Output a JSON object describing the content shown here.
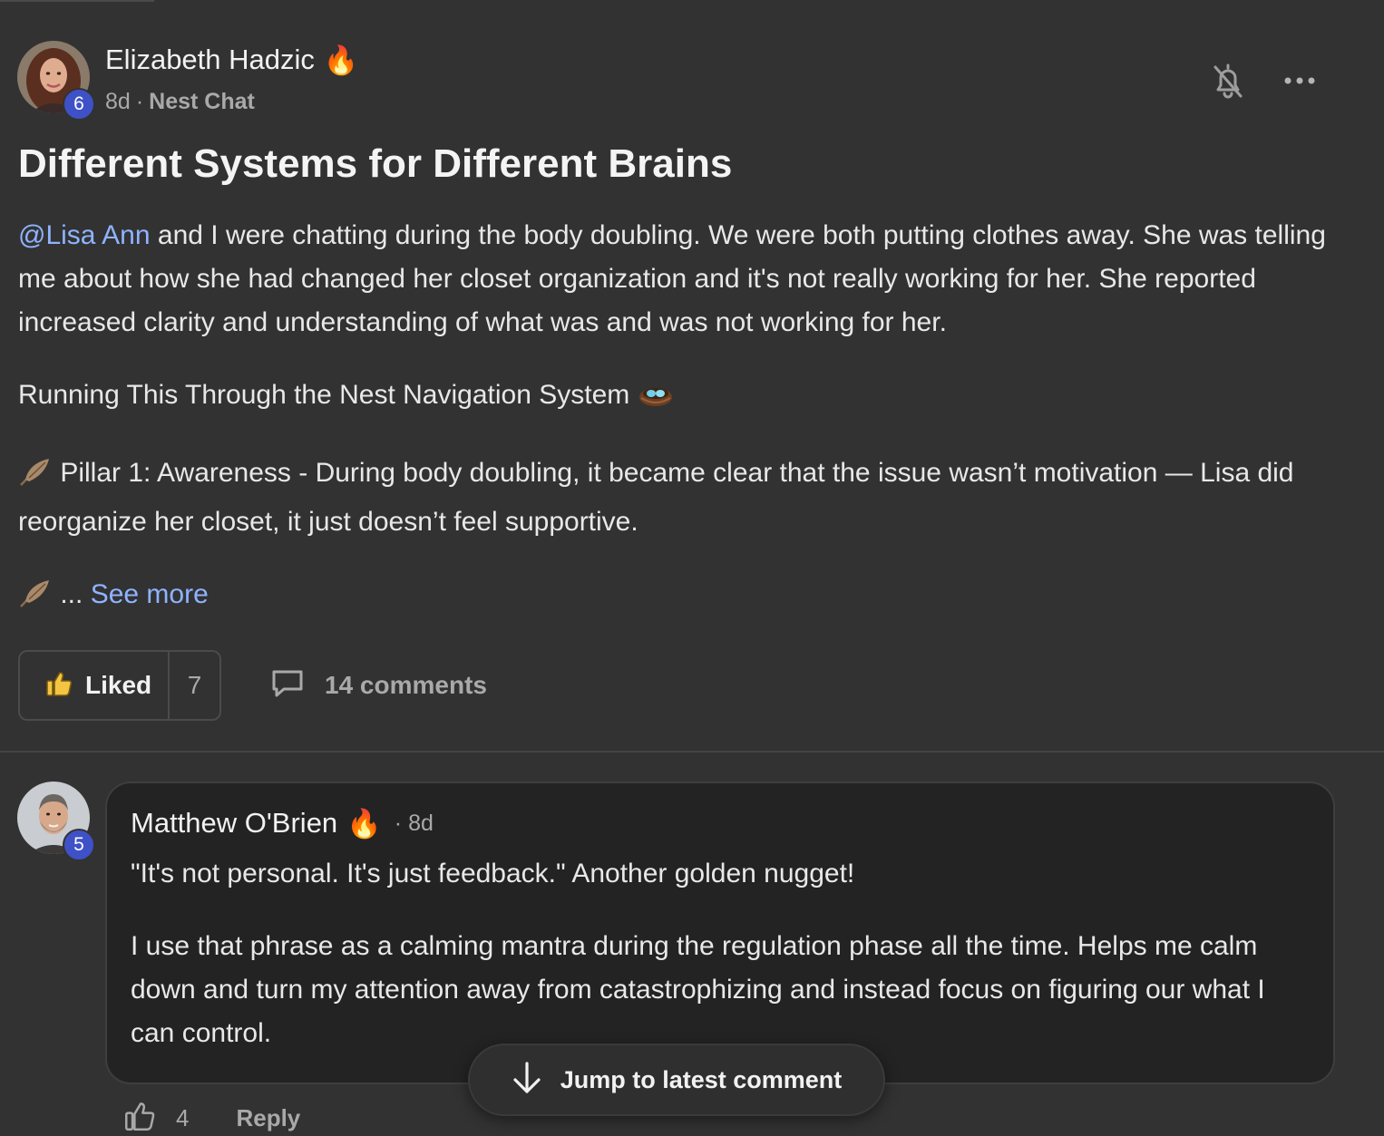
{
  "post": {
    "author": {
      "name": "Elizabeth Hadzic",
      "level": "6",
      "flair": "🔥"
    },
    "time": "8d",
    "category": "Nest Chat",
    "title": "Different Systems for Different Brains",
    "body": {
      "p1_mention": "@Lisa Ann",
      "p1_text": " and I were chatting during the body doubling. We were both putting clothes away. She was telling me about how she had changed her closet organization and it's not really working for her. She reported increased clarity and understanding of what was and was not working for her.",
      "p2_text": "Running This Through the Nest Navigation System",
      "p3_text": "Pillar 1: Awareness - During body doubling, it became clear that the issue wasn’t motivation — Lisa did reorganize her closet, it just doesn’t feel supportive.",
      "p4_ellipsis": "...",
      "see_more": "See more"
    },
    "actions": {
      "like_label": "Liked",
      "like_count": "7",
      "comments_label": "14 comments"
    }
  },
  "comment": {
    "author": {
      "name": "Matthew O'Brien",
      "level": "5",
      "flair": "🔥"
    },
    "time": "8d",
    "p1": "\"It's not personal. It's just feedback.\" Another golden nugget!",
    "p2": "I use that phrase as a calming mantra during the regulation phase all the time. Helps me calm down and turn my attention away from catastrophizing and instead focus on figuring our what I can control.",
    "like_count": "4",
    "reply_label": "Reply"
  },
  "jump_button": {
    "label": "Jump to latest comment"
  },
  "icons": {
    "bell": "bell-off-icon",
    "more": "more-horizontal-icon",
    "thumb": "thumbs-up-icon",
    "comment": "comment-bubble-icon",
    "arrow": "arrow-down-icon",
    "feather": "feather-icon",
    "nest": "nest-icon"
  },
  "colors": {
    "background": "#323232",
    "card": "#232323",
    "link": "#8fb3ff",
    "badge": "#3f51c7"
  }
}
